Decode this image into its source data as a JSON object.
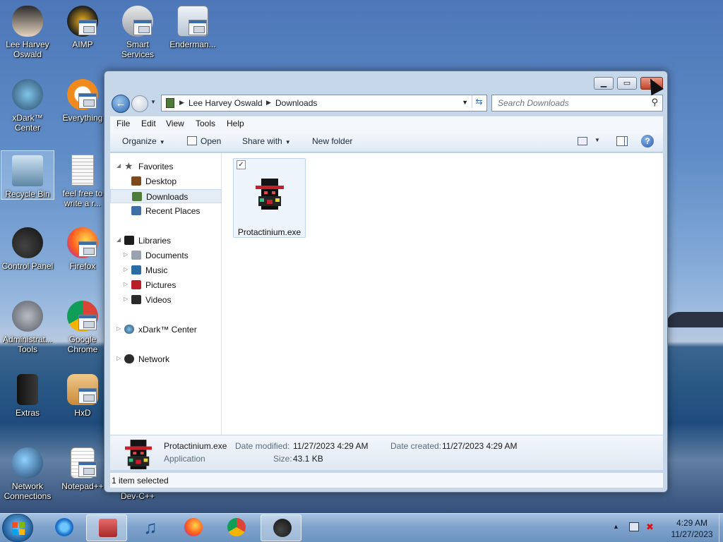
{
  "desktop": {
    "icons": [
      {
        "label": "Lee Harvey Oswald"
      },
      {
        "label": "AIMP"
      },
      {
        "label": "Smart Services"
      },
      {
        "label": "Enderman..."
      },
      {
        "label": "xDark™ Center"
      },
      {
        "label": "Everything"
      },
      {
        "label": "Recycle Bin"
      },
      {
        "label": "feel free to write a r..."
      },
      {
        "label": "Control Panel"
      },
      {
        "label": "Firefox"
      },
      {
        "label": "Administrat... Tools"
      },
      {
        "label": "Google Chrome"
      },
      {
        "label": "Extras"
      },
      {
        "label": "HxD"
      },
      {
        "label": "Network Connections"
      },
      {
        "label": "Notepad++"
      },
      {
        "label": "Dev-C++"
      }
    ]
  },
  "window": {
    "breadcrumb": [
      "Lee Harvey Oswald",
      "Downloads"
    ],
    "search_placeholder": "Search Downloads",
    "menu": [
      "File",
      "Edit",
      "View",
      "Tools",
      "Help"
    ],
    "toolbar": {
      "organize": "Organize",
      "open": "Open",
      "share_with": "Share with",
      "new_folder": "New folder"
    },
    "nav": {
      "favorites": "Favorites",
      "desktop": "Desktop",
      "downloads": "Downloads",
      "recent_places": "Recent Places",
      "libraries": "Libraries",
      "documents": "Documents",
      "music": "Music",
      "pictures": "Pictures",
      "videos": "Videos",
      "xdark_center": "xDark™ Center",
      "network": "Network"
    },
    "files": [
      {
        "name": "Protactinium.exe",
        "checked": "✓"
      }
    ],
    "details": {
      "name": "Protactinium.exe",
      "type": "Application",
      "date_modified_label": "Date modified:",
      "date_modified": "11/27/2023 4:29 AM",
      "date_created_label": "Date created:",
      "date_created": "11/27/2023 4:29 AM",
      "size_label": "Size:",
      "size": "43.1 KB"
    },
    "status": "1 item selected"
  },
  "taskbar": {
    "time": "4:29 AM",
    "date": "11/27/2023"
  }
}
